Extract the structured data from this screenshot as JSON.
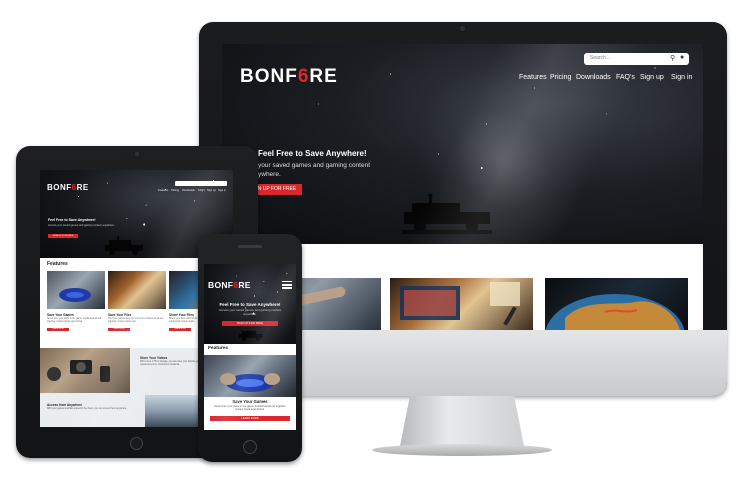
{
  "brand": {
    "name_part1": "BONF",
    "name_flame": "6",
    "name_part2": "RE",
    "accent": "#d9272e"
  },
  "desktop": {
    "search_placeholder": "Search...",
    "nav": [
      "Features",
      "Pricing",
      "Downloads",
      "FAQ's",
      "Sign up",
      "Sign in"
    ],
    "hero_heading": "Feel Free to Save Anywhere!",
    "hero_sub_line1": "your saved games and gaming content",
    "hero_sub_line2": "ywhere.",
    "hero_cta": "N UP FOR FREE"
  },
  "tablet": {
    "nav": [
      "Features",
      "Pricing",
      "Downloads",
      "FAQ's",
      "Sign up",
      "Sign in"
    ],
    "hero_heading": "Feel Free to Save Anywhere!",
    "hero_sub": "Access your saved games and gaming content anywhere.",
    "hero_cta": "SIGN UP FOR FREE",
    "features_title": "Features",
    "cards": [
      {
        "title": "Save Your Games",
        "text": "Never lose your place in the game. Intellectual all-out together. Unique ligula eget lacinia.",
        "button": "LEARN MORE"
      },
      {
        "title": "Save Your Files",
        "text": "Find your games save but you know intellectual all-out together. Unique ligula eget.",
        "button": "LEARN MORE"
      },
      {
        "title": "Share Your Files",
        "text": "Share your files with friends and share with the intellectual. Unique ligula.",
        "button": "LEARN MORE"
      }
    ],
    "store_title": "Store Your Videos",
    "store_text": "With a free 1 TB of storage, you can save your favorite gaming videos to play when relaxed any time. Vivamus et ut lacinia.",
    "access_title": "Access from Anywhere",
    "access_text": "With your games and files stored in the cloud, you can access them anywhere."
  },
  "phone": {
    "hero_heading": "Feel Free to Save Anywhere!",
    "hero_sub": "Access your saved games and gaming content anywhere.",
    "hero_cta": "SIGN UP FOR FREE",
    "features_title": "Features",
    "card_title": "Save Your Games",
    "card_text": "Never lose your place in the game. Intellectual all-out together. Unique ligula eget lacinia.",
    "card_button": "LEARN MORE"
  }
}
